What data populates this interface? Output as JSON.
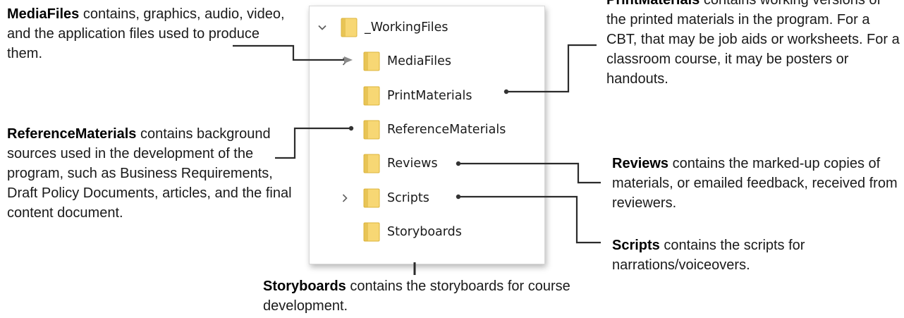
{
  "tree": {
    "root": {
      "label": "_WorkingFiles",
      "expanded": true
    },
    "items": [
      {
        "label": "MediaFiles",
        "has_children": true
      },
      {
        "label": "PrintMaterials",
        "has_children": false
      },
      {
        "label": "ReferenceMaterials",
        "has_children": false
      },
      {
        "label": "Reviews",
        "has_children": false
      },
      {
        "label": "Scripts",
        "has_children": true
      },
      {
        "label": "Storyboards",
        "has_children": false
      }
    ],
    "icons": {
      "expand": "chevron-down-icon",
      "collapse": "chevron-right-icon",
      "folder": "folder-icon"
    }
  },
  "annotations": {
    "mediafiles": {
      "term": "MediaFiles",
      "text": " contains, graphics, audio, video, and the application files used to produce them."
    },
    "printmaterials": {
      "term": "PrintMaterials",
      "text": " contains working versions of the printed materials in the program. For a CBT, that may be job aids or worksheets. For a classroom course, it may be posters or handouts."
    },
    "referencematerials": {
      "term": "ReferenceMaterials",
      "text": " contains background sources used in the development of the program, such as Business Requirements, Draft Policy Documents, articles, and the final content document."
    },
    "reviews": {
      "term": "Reviews",
      "text": " contains the marked-up copies of materials, or emailed feedback, received from reviewers."
    },
    "scripts": {
      "term": "Scripts",
      "text": " contains the scripts for narrations/voiceovers."
    },
    "storyboards": {
      "term": "Storyboards",
      "text": " contains the storyboards for course development."
    }
  },
  "colors": {
    "folder_fill": "#f7d774",
    "folder_edge": "#dcb43c",
    "connector": "#2b2b2b",
    "chevron": "#606060"
  }
}
